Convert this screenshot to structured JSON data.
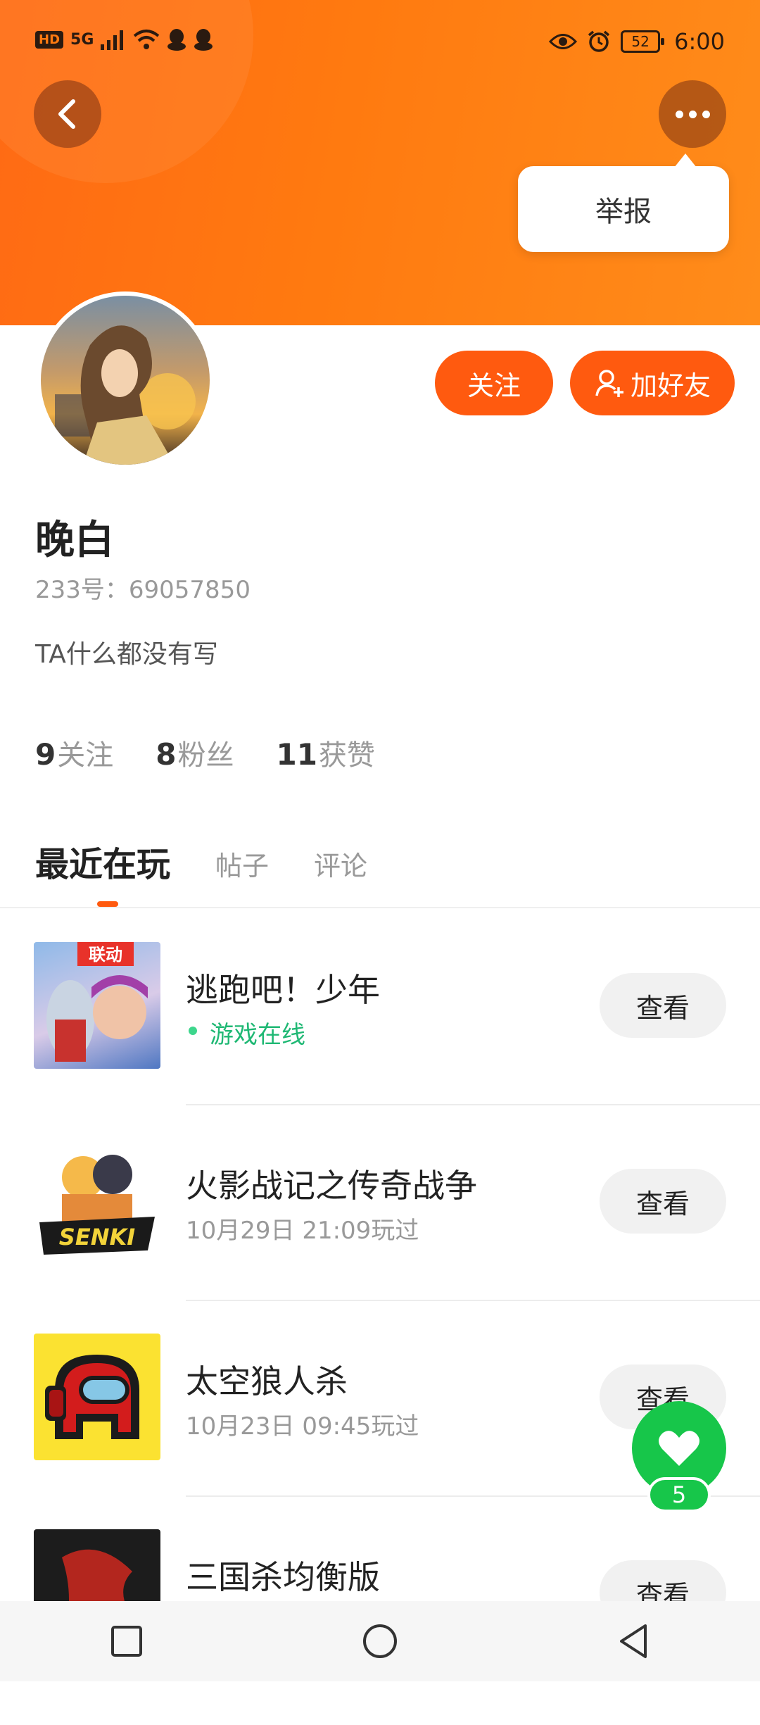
{
  "status_bar": {
    "hd": "HD",
    "network": "5G",
    "battery": "52",
    "time": "6:00",
    "icons": [
      "hd-icon",
      "signal-icon",
      "wifi-icon",
      "qq-icon",
      "qq-icon",
      "eye-icon",
      "alarm-icon",
      "battery-icon"
    ]
  },
  "header": {
    "back_icon": "chevron-left-icon",
    "more_icon": "more-dots-icon",
    "popup_item": "举报"
  },
  "profile": {
    "name": "晚白",
    "uid": "233号：69057850",
    "bio": "TA什么都没有写",
    "follow_label": "关注",
    "add_friend_label": "加好友"
  },
  "stats": [
    {
      "value": "9",
      "label": "关注"
    },
    {
      "value": "8",
      "label": "粉丝"
    },
    {
      "value": "11",
      "label": "获赞"
    }
  ],
  "tabs": [
    {
      "label": "最近在玩",
      "active": true
    },
    {
      "label": "帖子",
      "active": false
    },
    {
      "label": "评论",
      "active": false
    }
  ],
  "games": [
    {
      "title": "逃跑吧！少年",
      "sub": "游戏在线",
      "online": true,
      "button": "查看",
      "badge": "联动"
    },
    {
      "title": "火影战记之传奇战争",
      "sub": "10月29日 21:09玩过",
      "online": false,
      "button": "查看",
      "badge": "SENKI"
    },
    {
      "title": "太空狼人杀",
      "sub": "10月23日 09:45玩过",
      "online": false,
      "button": "查看"
    },
    {
      "title": "三国杀均衡版",
      "sub": "",
      "online": false,
      "button": "查看"
    }
  ],
  "like": {
    "count": "5"
  },
  "colors": {
    "accent": "#ff5a0f",
    "header": "#ff7a10",
    "online": "#1fb874",
    "like": "#17c64a"
  }
}
